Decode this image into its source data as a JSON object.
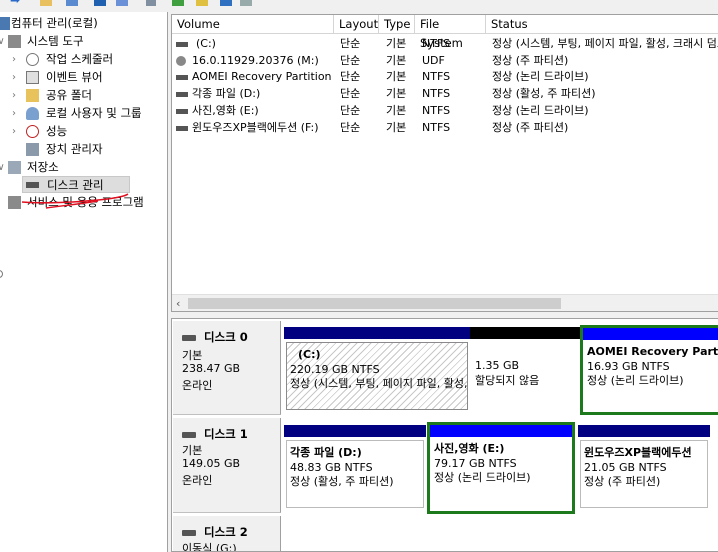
{
  "tree": {
    "items": [
      {
        "label": "컴퓨터 관리(로컬)",
        "icon": "computer-management-icon"
      },
      {
        "label": "시스템 도구",
        "icon": "system-tools-icon"
      },
      {
        "label": "작업 스케줄러",
        "icon": "task-scheduler-icon"
      },
      {
        "label": "이벤트 뷰어",
        "icon": "event-viewer-icon"
      },
      {
        "label": "공유 폴더",
        "icon": "shared-folders-icon"
      },
      {
        "label": "로컬 사용자 및 그룹",
        "icon": "local-users-icon"
      },
      {
        "label": "성능",
        "icon": "performance-icon"
      },
      {
        "label": "장치 관리자",
        "icon": "device-manager-icon"
      },
      {
        "label": "저장소",
        "icon": "storage-icon"
      },
      {
        "label": "디스크 관리",
        "icon": "disk-management-icon"
      },
      {
        "label": "서비스 및 응용 프로그램",
        "icon": "services-icon"
      }
    ]
  },
  "volume_list": {
    "columns": [
      "Volume",
      "Layout",
      "Type",
      "File System",
      "Status"
    ],
    "rows": [
      {
        "volume": "(C:)",
        "layout": "단순",
        "type": "기본",
        "fs": "NTFS",
        "status": "정상 (시스템, 부팅, 페이지 파일, 활성, 크래시 덤프, 주 파티션)"
      },
      {
        "volume": "16.0.11929.20376 (M:)",
        "layout": "단순",
        "type": "기본",
        "fs": "UDF",
        "status": "정상 (주 파티션)"
      },
      {
        "volume": "AOMEI Recovery Partition",
        "layout": "단순",
        "type": "기본",
        "fs": "NTFS",
        "status": "정상 (논리 드라이브)"
      },
      {
        "volume": "각종 파일 (D:)",
        "layout": "단순",
        "type": "기본",
        "fs": "NTFS",
        "status": "정상 (활성, 주 파티션)"
      },
      {
        "volume": "사진,영화 (E:)",
        "layout": "단순",
        "type": "기본",
        "fs": "NTFS",
        "status": "정상 (논리 드라이브)"
      },
      {
        "volume": "윈도우즈XP블랙에두션 (F:)",
        "layout": "단순",
        "type": "기본",
        "fs": "NTFS",
        "status": "정상 (주 파티션)"
      }
    ],
    "scroll_left_arrow": "‹"
  },
  "disks": [
    {
      "name": "디스크 0",
      "kind": "기본",
      "size": "238.47 GB",
      "state": "온라인",
      "partitions": [
        {
          "title": "(C:)",
          "size": "220.19 GB NTFS",
          "status": "정상 (시스템, 부팅, 페이지 파일, 활성, 크래시 덤프, 주 파티션)"
        },
        {
          "title": "",
          "size": "1.35 GB",
          "status": "할당되지 않음"
        },
        {
          "title": "AOMEI Recovery Partition",
          "size": "16.93 GB NTFS",
          "status": "정상 (논리 드라이브)"
        }
      ]
    },
    {
      "name": "디스크 1",
      "kind": "기본",
      "size": "149.05 GB",
      "state": "온라인",
      "partitions": [
        {
          "title": "각종 파일  (D:)",
          "size": "48.83 GB NTFS",
          "status": "정상 (활성, 주 파티션)"
        },
        {
          "title": "사진,영화  (E:)",
          "size": "79.17 GB NTFS",
          "status": "정상 (논리 드라이브)"
        },
        {
          "title": "윈도우즈XP블랙에두션",
          "size": "21.05 GB NTFS",
          "status": "정상 (주 파티션)"
        }
      ]
    },
    {
      "name": "디스크 2",
      "kind": "이동식 (G:)"
    }
  ],
  "colors": {
    "primary_bar": "#000080",
    "logical_bar": "#0000ff",
    "unallocated_bar": "#000000",
    "selection_green": "#1c7a1c",
    "annotation_red": "#e01020"
  }
}
